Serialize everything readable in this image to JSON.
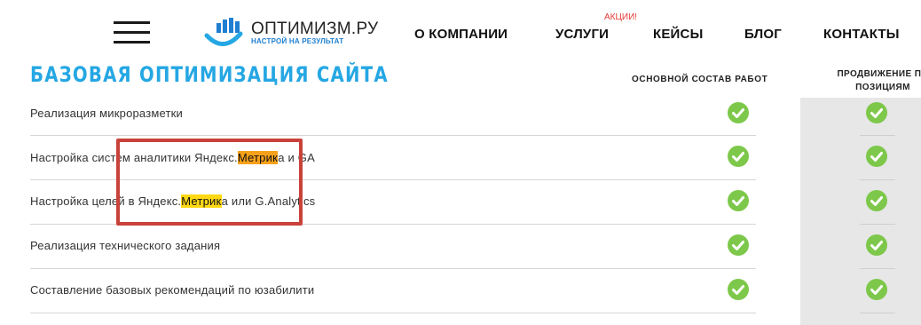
{
  "header": {
    "logo": {
      "name": "ОПТИМИЗМ.РУ",
      "tagline": "НАСТРОЙ НА РЕЗУЛЬТАТ",
      "brand_color": "#1f7fd1"
    },
    "nav": [
      {
        "label": "О КОМПАНИИ"
      },
      {
        "label": "УСЛУГИ",
        "badge": "АКЦИИ!"
      },
      {
        "label": "КЕЙСЫ"
      },
      {
        "label": "БЛОГ"
      },
      {
        "label": "КОНТАКТЫ"
      }
    ]
  },
  "section": {
    "title": "БАЗОВАЯ ОПТИМИЗАЦИЯ САЙТА",
    "title_color": "#25a7e3",
    "columns": [
      "ОСНОВНОЙ СОСТАВ РАБОТ",
      "ПРОДВИЖЕНИЕ ПО ПОЗИЦИЯМ"
    ]
  },
  "rows": [
    {
      "label": "Реализация микроразметки",
      "basic": true,
      "promotion": true
    },
    {
      "label_before": "Настройка систем аналитики Яндекс.",
      "label_highlight": "Метрик",
      "label_after": "а и GA",
      "highlight_color": "#f7a11a",
      "basic": true,
      "promotion": true
    },
    {
      "label_before": "Настройка целей в Яндекс.",
      "label_highlight": "Метрик",
      "label_after": "а или G.Analytics",
      "highlight_color": "#ffd814",
      "basic": true,
      "promotion": true
    },
    {
      "label": "Реализация технического задания",
      "basic": true,
      "promotion": true
    },
    {
      "label": "Составление базовых рекомендаций по юзабилити",
      "basic": true,
      "promotion": true
    }
  ],
  "icons": {
    "menu": "hamburger-menu-icon",
    "included": "check-circle-icon"
  },
  "colors": {
    "check": "#7dc84a",
    "annotation": "#c9423a",
    "gray_column": "#e7e7e7"
  }
}
